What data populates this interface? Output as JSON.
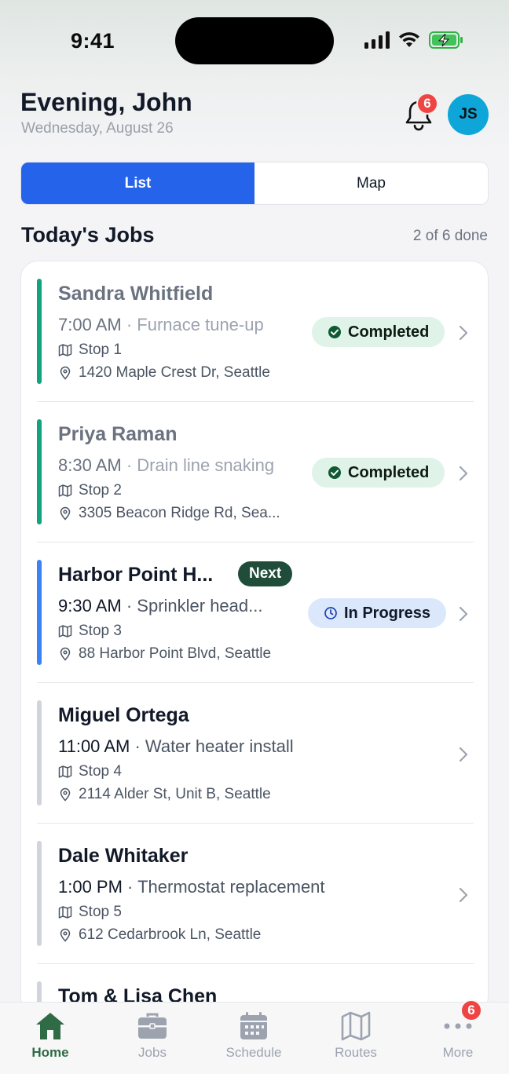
{
  "status_bar": {
    "time": "9:41"
  },
  "header": {
    "greeting": "Evening, John",
    "date": "Wednesday, August 26",
    "notifications_count": "6",
    "avatar_initials": "JS"
  },
  "view_toggle": {
    "list_label": "List",
    "map_label": "Map",
    "selected": "List"
  },
  "jobs_section": {
    "title": "Today's Jobs",
    "progress": "2 of 6 done"
  },
  "jobs": [
    {
      "customer": "Sandra Whitfield",
      "time": "7:00 AM",
      "service": "Furnace tune-up",
      "stop": "Stop 1",
      "address": "1420 Maple Crest Dr, Seattle",
      "status": "Completed"
    },
    {
      "customer": "Priya Raman",
      "time": "8:30 AM",
      "service": "Drain line snaking",
      "stop": "Stop 2",
      "address": "3305 Beacon Ridge Rd, Sea...",
      "status": "Completed"
    },
    {
      "customer": "Harbor Point H...",
      "badge": "Next",
      "time": "9:30 AM",
      "service": "Sprinkler head...",
      "stop": "Stop 3",
      "address": "88 Harbor Point Blvd, Seattle",
      "status": "In Progress"
    },
    {
      "customer": "Miguel Ortega",
      "time": "11:00 AM",
      "service": "Water heater install",
      "stop": "Stop 4",
      "address": "2114 Alder St, Unit B, Seattle",
      "status": ""
    },
    {
      "customer": "Dale Whitaker",
      "time": "1:00 PM",
      "service": "Thermostat replacement",
      "stop": "Stop 5",
      "address": "612 Cedarbrook Ln, Seattle",
      "status": ""
    },
    {
      "customer": "Tom & Lisa Chen"
    }
  ],
  "colors": {
    "completed_bar": "#10a37f",
    "in_progress_bar": "#3b82f6",
    "pending_bar": "#d1d5db",
    "accent_blue": "#2563eb",
    "home_green": "#2f6b45",
    "badge_red": "#ef4444"
  },
  "tab_bar": {
    "tabs": [
      {
        "label": "Home",
        "icon": "home-icon"
      },
      {
        "label": "Jobs",
        "icon": "briefcase-icon"
      },
      {
        "label": "Schedule",
        "icon": "calendar-icon"
      },
      {
        "label": "Routes",
        "icon": "map-icon"
      },
      {
        "label": "More",
        "icon": "more-icon"
      }
    ],
    "more_badge": "6"
  }
}
